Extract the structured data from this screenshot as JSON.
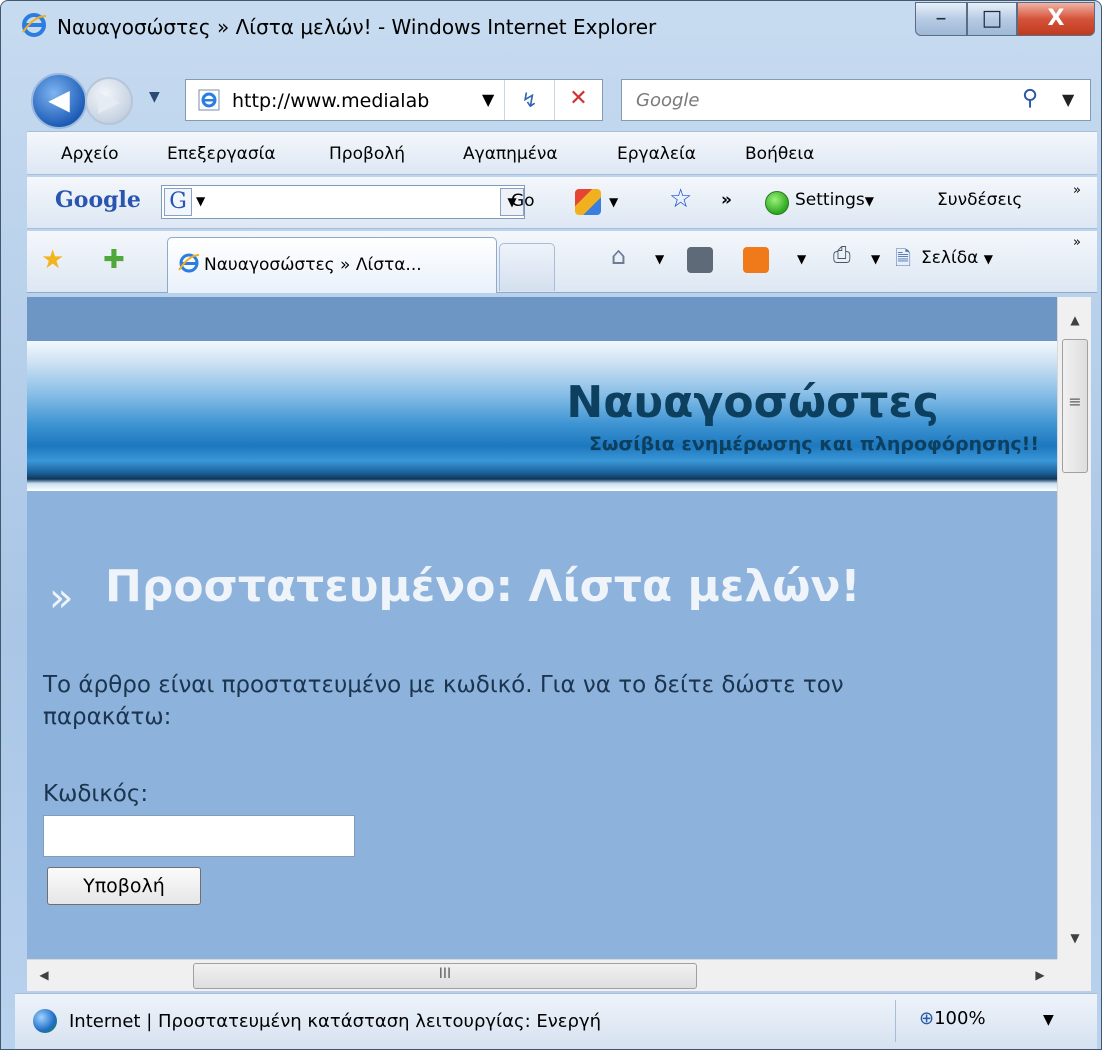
{
  "window": {
    "title": "Ναυαγοσώστες » Λίστα μελών! - Windows Internet Explorer",
    "min_glyph": "–",
    "max_glyph": "□",
    "close_glyph": "X"
  },
  "address_bar": {
    "url": "http://www.medialab",
    "search_placeholder": "Google"
  },
  "menu": [
    {
      "label": "Αρχείο"
    },
    {
      "label": "Επεξεργασία"
    },
    {
      "label": "Προβολή"
    },
    {
      "label": "Αγαπημένα"
    },
    {
      "label": "Εργαλεία"
    },
    {
      "label": "Βοήθεια"
    }
  ],
  "google_toolbar": {
    "logo": "Google",
    "mini_logo": "G",
    "go_label": "Go",
    "settings_label": "Settings",
    "links_label": "Συνδέσεις",
    "overflow": "»"
  },
  "tabs": {
    "active_label": "Ναυαγοσώστες » Λίστα...",
    "page_menu_label": "Σελίδα",
    "overflow": "»"
  },
  "page": {
    "site_title": "Ναυαγοσώστες",
    "site_subtitle": "Σωσίβια ενημέρωσης και πληροφόρησης!!",
    "post_title": "Προστατευμένο: Λίστα μελών!",
    "body_line1": "Το άρθρο είναι προστατευμένο με κωδικό. Για να το δείτε δώστε τον",
    "body_line2": "παρακάτω:",
    "password_label": "Κωδικός:",
    "password_value": "",
    "submit_label": "Υποβολή"
  },
  "scroll": {
    "grip": "III",
    "grip_v": "≡"
  },
  "status": {
    "text": "Internet | Προστατευμένη κατάσταση λειτουργίας: Ενεργή",
    "zoom": "100%"
  }
}
